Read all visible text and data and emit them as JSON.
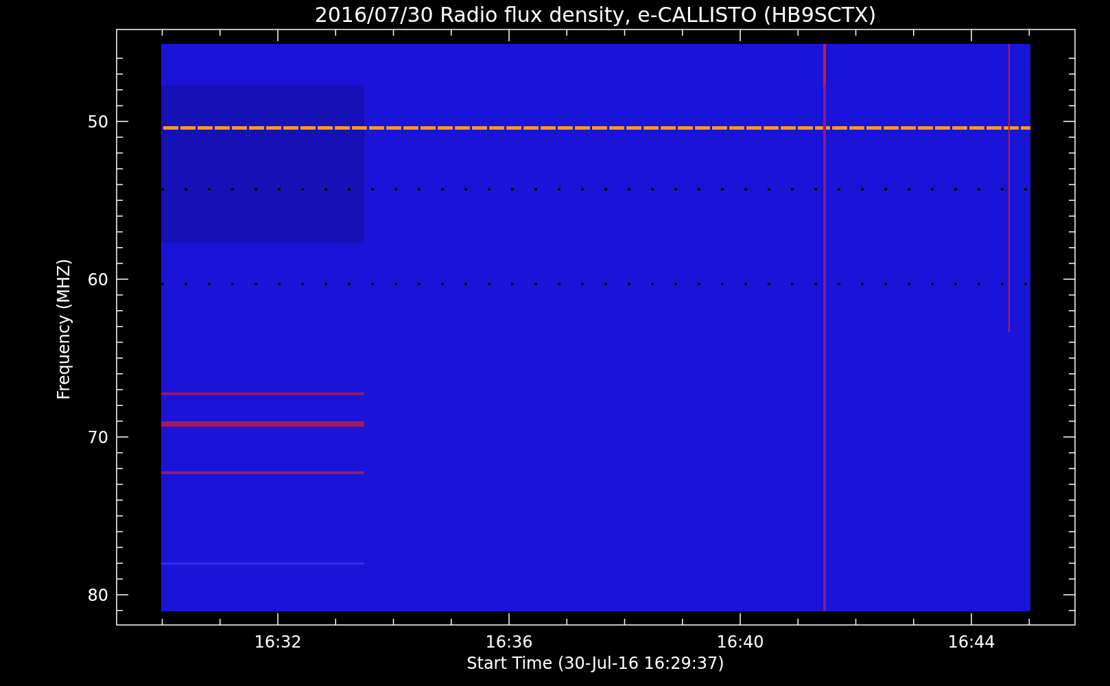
{
  "plot": {
    "title": "2016/07/30  Radio flux density, e-CALLISTO (HB9SCTX)",
    "ylabel": "Frequency (MHZ)",
    "xlabel": "Start Time (30-Jul-16 16:29:37)",
    "yticks": [
      "50",
      "60",
      "70",
      "80"
    ],
    "xticks": [
      "16:32",
      "16:36",
      "16:40",
      "16:44"
    ]
  }
}
